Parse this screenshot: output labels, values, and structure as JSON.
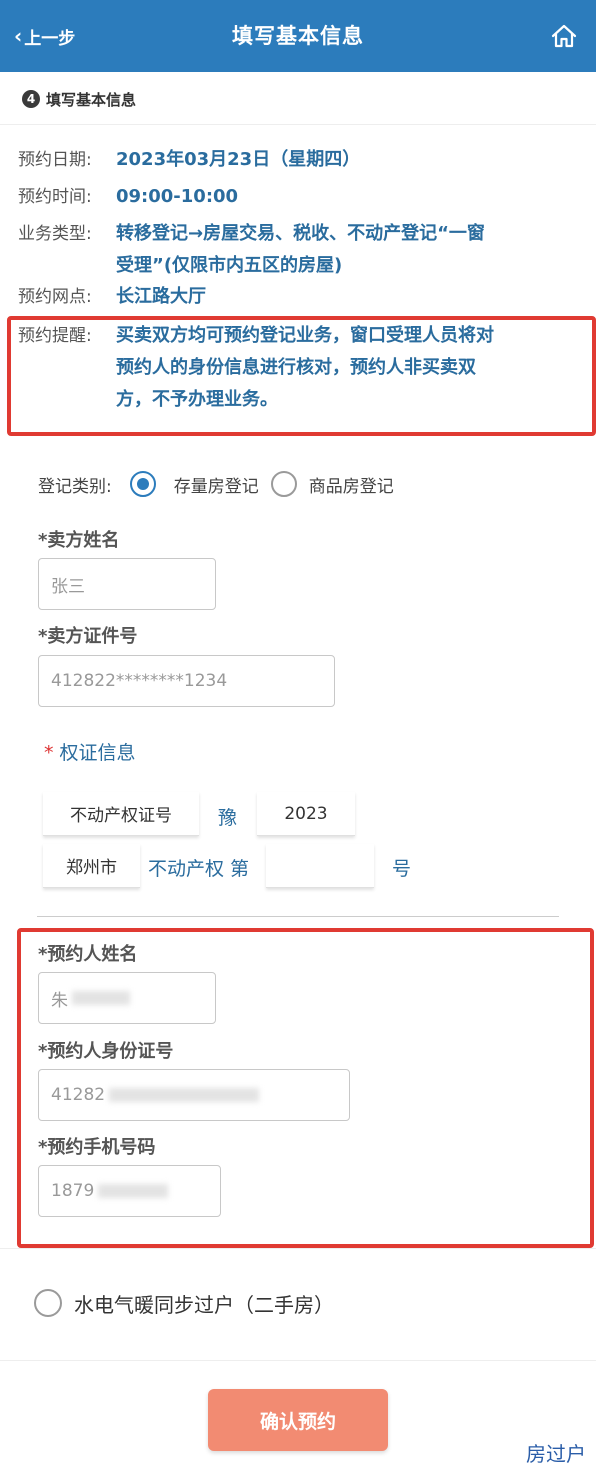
{
  "header": {
    "back_label": "上一步",
    "title": "填写基本信息"
  },
  "step": {
    "number": "4",
    "label": "填写基本信息"
  },
  "info": {
    "date_label": "预约日期:",
    "date_value": "2023年03月23日（星期四）",
    "time_label": "预约时间:",
    "time_value": "09:00-10:00",
    "type_label": "业务类型:",
    "type_value_line1": "转移登记→房屋交易、税收、不动产登记“一窗",
    "type_value_line2": "受理”(仅限市内五区的房屋)",
    "site_label": "预约网点:",
    "site_value": "长江路大厅",
    "remind_label": "预约提醒:",
    "remind_line1": "买卖双方均可预约登记业务，窗口受理人员将对",
    "remind_line2": "预约人的身份信息进行核对，预约人非买卖双",
    "remind_line3": "方，不予办理业务。"
  },
  "registration": {
    "label": "登记类别:",
    "options": [
      "存量房登记",
      "商品房登记"
    ],
    "selected": "存量房登记"
  },
  "seller": {
    "name_label": "*卖方姓名",
    "name_value": "张三",
    "id_label": "*卖方证件号",
    "id_value": "412822********1234"
  },
  "certificate": {
    "title": "权证信息",
    "cert_type": "不动产权证号",
    "province": "豫",
    "year": "2023",
    "city": "郑州市",
    "mid_text": "不动产权 第",
    "number_value": "",
    "suffix": "号"
  },
  "applicant": {
    "name_label": "*预约人姓名",
    "name_value": "朱",
    "id_label": "*预约人身份证号",
    "id_value": "41282",
    "phone_label": "*预约手机号码",
    "phone_value": "1879"
  },
  "sync": {
    "label": "水电气暖同步过户（二手房）"
  },
  "confirm_label": "确认预约",
  "watermark": "房过户",
  "colors": {
    "header": "#2c7cbc",
    "accent_text": "#2a6c9e",
    "highlight_border": "#e03a32",
    "confirm_button": "#f28b72"
  }
}
